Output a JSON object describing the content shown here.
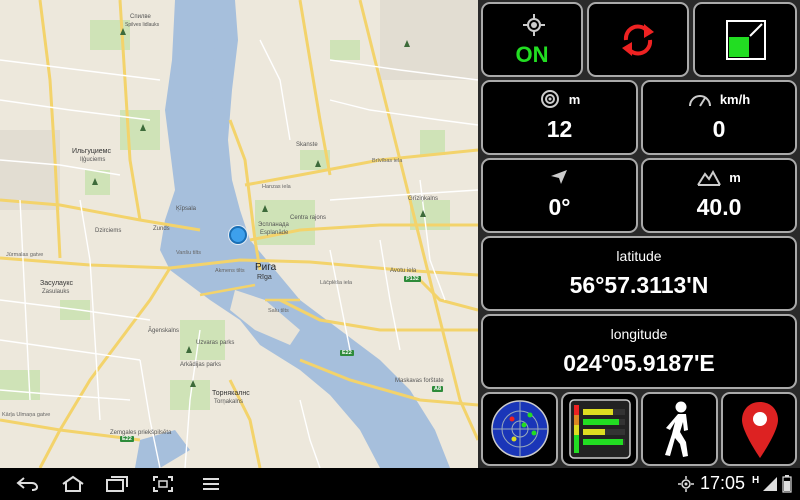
{
  "map": {
    "city_ru": "Рига",
    "city_lv": "Rīga",
    "labels": {
      "spilve_ru": "Спилве",
      "spilve_lv": "Spilves lidlauks",
      "ilguciems_ru": "Ильгуциемс",
      "ilguciems_lv": "Iļģuciems",
      "zasulauks_ru": "Засулаукс",
      "zasulauks_lv": "Zasulauks",
      "torniakalns_ru": "Торнякалнс",
      "torniakalns_lv": "Torņakalns",
      "esplanade_ru": "Эспланада",
      "esplanade_lv": "Esplanāde",
      "centra": "Centra rajons",
      "skanste": "Skanste",
      "dzirciems": "Dzirciems",
      "kipsala": "Ķīpsala",
      "zunds": "Zunds",
      "agenskalns": "Āgenskalns",
      "arkadijas": "Arkādijas parks",
      "grizinkalns": "Grīziņkalns",
      "avotu": "Avotu iela",
      "maskavas": "Maskavas forštate",
      "zemgales": "Zemgales priekšpilsēta",
      "uzvaras": "Uzvaras parks",
      "kipsala_b": "Kīpsalas iela",
      "karla_ulmana": "Kārļa Ulmaņa gatve",
      "jurmalas": "Jūrmalas gatve",
      "hanzas": "Hanzas iela",
      "brivibas": "Brīvības iela",
      "lacplesa": "Lāčplēša iela",
      "akmens": "Akmens tilts",
      "vansu": "Vanšu tilts",
      "salu": "Salu tilts",
      "e22": "E22",
      "a8": "A8",
      "p132": "P132"
    }
  },
  "panel": {
    "gps_status": "ON",
    "accuracy_unit": "m",
    "accuracy_value": "12",
    "speed_unit": "km/h",
    "speed_value": "0",
    "heading_value": "0°",
    "altitude_unit": "m",
    "altitude_value": "40.0",
    "latitude_label": "latitude",
    "latitude_value": "56°57.3113'N",
    "longitude_label": "longitude",
    "longitude_value": "024°05.9187'E"
  },
  "statusbar": {
    "time": "17:05",
    "network": "H"
  },
  "colors": {
    "gps_on": "#22dd22",
    "refresh": "#ee2222",
    "pin": "#dd2222"
  }
}
